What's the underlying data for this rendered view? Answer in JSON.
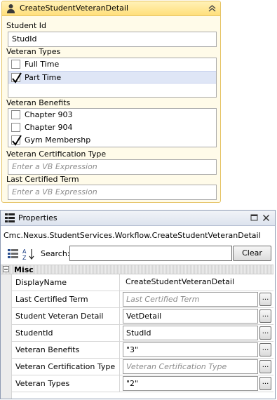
{
  "activity": {
    "title": "CreateStudentVeteranDetail",
    "student_id_label": "Student Id",
    "student_id_value": "StudId",
    "veteran_types_label": "Veteran Types",
    "veteran_types": [
      {
        "label": "Full Time",
        "checked": false
      },
      {
        "label": "Part Time",
        "checked": true
      }
    ],
    "veteran_benefits_label": "Veteran Benefits",
    "veteran_benefits": [
      {
        "label": "Chapter 903",
        "checked": false
      },
      {
        "label": "Chapter 904",
        "checked": false
      },
      {
        "label": "Gym Membershp",
        "checked": true
      }
    ],
    "cert_type_label": "Veteran Certification Type",
    "cert_type_placeholder": "Enter a VB Expression",
    "last_term_label": "Last Certified Term",
    "last_term_placeholder": "Enter a VB Expression"
  },
  "properties": {
    "title": "Properties",
    "object_name": "Cmc.Nexus.StudentServices.Workflow.CreateStudentVeteranDetail",
    "search_label": "Search:",
    "search_value": "",
    "clear_label": "Clear",
    "category": "Misc",
    "rows": [
      {
        "name": "DisplayName",
        "value": "CreateStudentVeteranDetail",
        "placeholder": false,
        "has_button": false
      },
      {
        "name": "Last Certified Term",
        "value": "Last Certified Term",
        "placeholder": true,
        "has_button": true
      },
      {
        "name": "Student Veteran Detail",
        "value": "VetDetail",
        "placeholder": false,
        "has_button": true
      },
      {
        "name": "StudentId",
        "value": "StudId",
        "placeholder": false,
        "has_button": true
      },
      {
        "name": "Veteran Benefits",
        "value": "\"3\"",
        "placeholder": false,
        "has_button": true
      },
      {
        "name": "Veteran Certification Type",
        "value": "Veteran Certification Type",
        "placeholder": true,
        "has_button": true
      },
      {
        "name": "Veteran Types",
        "value": "\"2\"",
        "placeholder": false,
        "has_button": true
      }
    ],
    "ellipsis_label": "..."
  },
  "colors": {
    "activity_border": "#e5c365",
    "activity_header": "#ffdf7a",
    "selected_item": "#dfe6f6"
  }
}
